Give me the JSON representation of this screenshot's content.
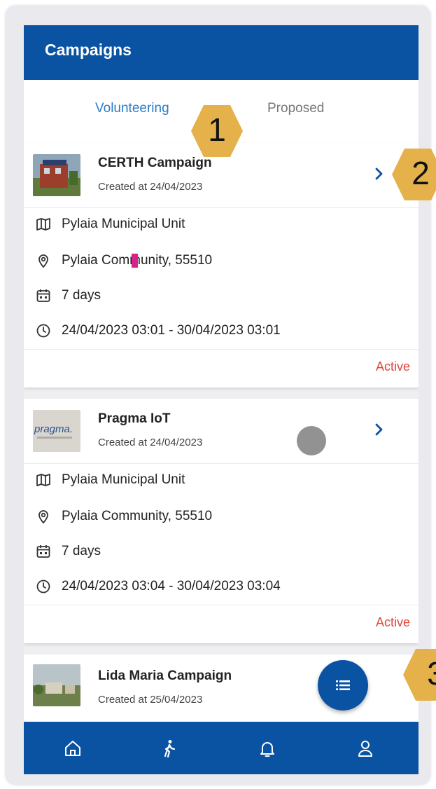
{
  "appbar": {
    "title": "Campaigns"
  },
  "tabs": [
    {
      "label": "Volunteering",
      "selected": true
    },
    {
      "label": "Proposed",
      "selected": false
    }
  ],
  "campaigns": [
    {
      "title": "CERTH Campaign",
      "created": "Created at 24/04/2023",
      "municipality": "Pylaia Municipal Unit",
      "location": "Pylaia Community, 55510",
      "duration": "7 days",
      "period": "24/04/2023 03:01 - 30/04/2023 03:01",
      "status": "Active"
    },
    {
      "title": "Pragma IoT",
      "created": "Created at 24/04/2023",
      "municipality": "Pylaia Municipal Unit",
      "location": "Pylaia Community, 55510",
      "duration": "7 days",
      "period": "24/04/2023 03:04 - 30/04/2023 03:04",
      "status": "Active"
    },
    {
      "title": "Lida Maria Campaign",
      "created": "Created at 25/04/2023"
    }
  ],
  "annotations": [
    "1",
    "2",
    "3"
  ],
  "colors": {
    "primary": "#0a53a3",
    "tab_active": "#2c7cc7",
    "status_active": "#e0453a",
    "badge": "#e4b14a"
  },
  "icons": {
    "nav": [
      "home-icon",
      "walk-icon",
      "bell-icon",
      "user-icon"
    ],
    "fab": "list-icon",
    "chevron": "chevron-right-icon"
  }
}
